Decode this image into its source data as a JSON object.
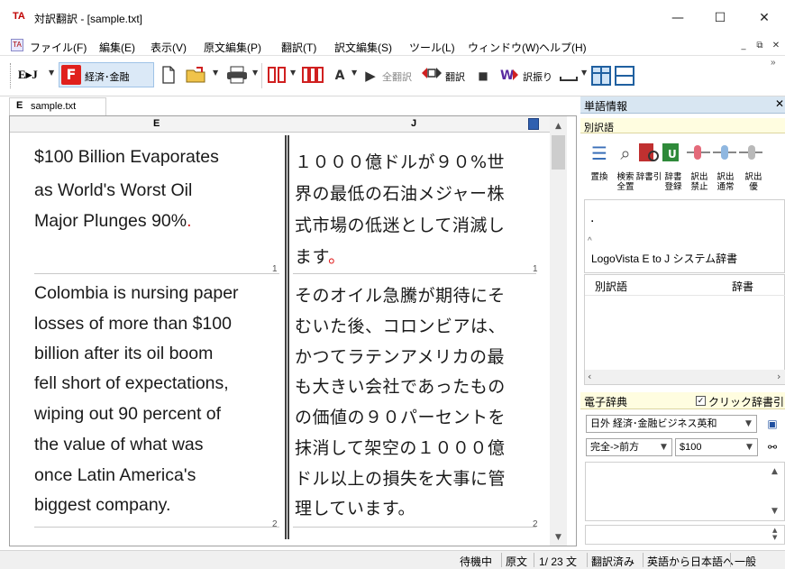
{
  "window": {
    "logo": "TA",
    "title": "対訳翻訳 - [sample.txt]",
    "minimize_glyph": "—",
    "maximize_glyph": "☐",
    "close_glyph": "✕"
  },
  "menu": {
    "items": [
      "ファイル(F)",
      "編集(E)",
      "表示(V)",
      "原文編集(P)",
      "翻訳(T)",
      "訳文編集(S)",
      "ツール(L)",
      "ウィンドウ(W)",
      "ヘルプ(H)"
    ],
    "mdi_min": "_",
    "mdi_restore": "⧉",
    "mdi_close": "✕"
  },
  "toolbar": {
    "direction_label": "E▸J",
    "field_badge": "F",
    "field_label": "経済･金融",
    "translate_all_label": "全翻訳",
    "translate_label": "翻訳",
    "word_split_label": "訳振り",
    "icons": [
      "new-document-icon",
      "open-folder-icon",
      "print-icon",
      "column-layout-icon",
      "multi-column-icon",
      "font-size-icon",
      "play-icon",
      "translate-icon",
      "stop-icon",
      "word-split-icon",
      "underline-icon",
      "layout-horizontal-icon",
      "layout-vertical-icon"
    ]
  },
  "document": {
    "tab_icon": "E",
    "tab_label": "sample.txt",
    "col_e_header": "E",
    "col_j_header": "J",
    "segments": [
      {
        "en": [
          "$100 Billion Evaporates",
          "as World's Worst Oil",
          "Major Plunges 90%"
        ],
        "en_end": ".",
        "ja": [
          "１０００億ドルが９０%世",
          "界の最低の石油メジャー株",
          "式市場の低迷として消滅し",
          "ます"
        ],
        "ja_end": "。",
        "number": "1"
      },
      {
        "en": [
          "Colombia is nursing paper",
          "losses of more than $100",
          "billion after its oil boom",
          "fell short of expectations,",
          "wiping out 90 percent of",
          "the value of what was",
          "once Latin America's",
          "biggest company."
        ],
        "ja": [
          "そのオイル急騰が期待にそ",
          "むいた後、コロンビアは、",
          "かつてラテンアメリカの最",
          "も大きい会社であったもの",
          "の価値の９０パーセントを",
          "抹消して架空の１０００億",
          "ドル以上の損失を大事に管",
          "理しています。"
        ],
        "number": "2"
      }
    ]
  },
  "word_panel": {
    "title": "単語情報",
    "close_glyph": "✕",
    "alt_translation_label": "別訳語",
    "buttons": [
      {
        "icon": "replace-icon",
        "label": "置換"
      },
      {
        "icon": "search-all-icon",
        "label": "検索\n全置"
      },
      {
        "icon": "dictionary-lookup-icon",
        "label": "辞書引"
      },
      {
        "icon": "dictionary-register-icon",
        "label": "辞書\n登録"
      },
      {
        "icon": "ban-translation-icon",
        "label": "訳出\n禁止"
      },
      {
        "icon": "normal-translation-icon",
        "label": "訳出\n通常"
      },
      {
        "icon": "priority-translation-icon",
        "label": "訳出\n優"
      }
    ],
    "dict_dot1": ".",
    "dict_dot2": "^",
    "system_dict_label": "LogoVista E to J システム辞書",
    "list_headers": [
      "別訳語",
      "辞書"
    ]
  },
  "edict_panel": {
    "title": "電子辞典",
    "click_lookup_label": "クリック辞書引",
    "click_lookup_checked": true,
    "dictionary_select": "日外 経済･金融ビジネス英和",
    "match_mode_select": "完全->前方",
    "search_value": "$100"
  },
  "status": {
    "items": [
      "待機中",
      "原文",
      "1/ 23 文",
      "翻訳済み",
      "英語から日本語へ",
      "一般"
    ]
  }
}
